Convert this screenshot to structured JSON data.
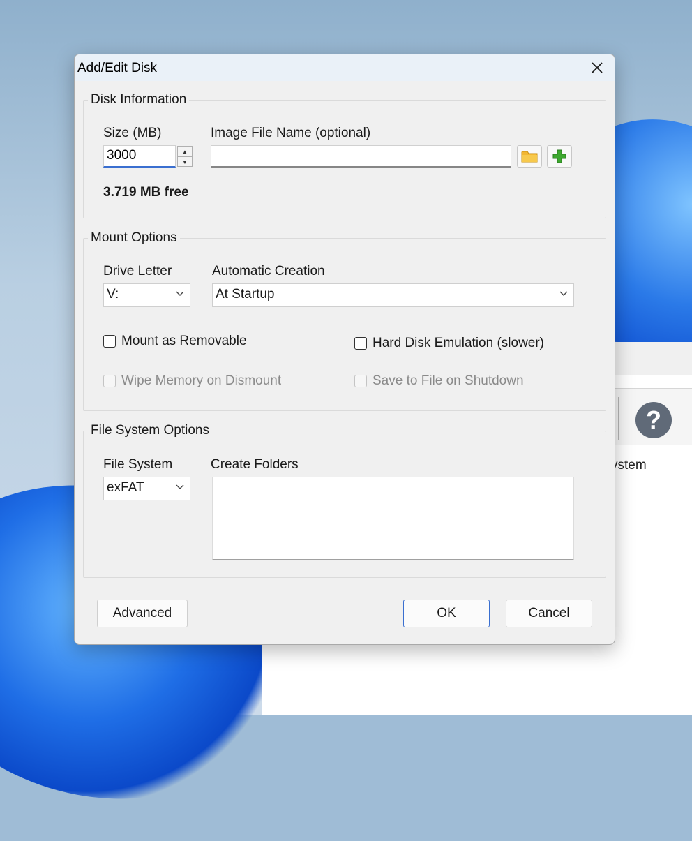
{
  "background_window": {
    "partial_label": "ystem"
  },
  "dialog": {
    "title": "Add/Edit Disk",
    "disk_info": {
      "group_title": "Disk Information",
      "size_label": "Size (MB)",
      "size_value": "3000",
      "image_file_label": "Image File Name (optional)",
      "image_file_value": "",
      "free_text": "3.719 MB free"
    },
    "mount": {
      "group_title": "Mount Options",
      "drive_letter_label": "Drive Letter",
      "drive_letter_value": "V:",
      "auto_creation_label": "Automatic Creation",
      "auto_creation_value": "At Startup",
      "mount_removable": "Mount as Removable",
      "hdd_emulation": "Hard Disk Emulation (slower)",
      "wipe_memory": "Wipe Memory on Dismount",
      "save_to_file": "Save to File on Shutdown"
    },
    "fs": {
      "group_title": "File System Options",
      "fs_label": "File System",
      "fs_value": "exFAT",
      "create_folders_label": "Create Folders"
    },
    "buttons": {
      "advanced": "Advanced",
      "ok": "OK",
      "cancel": "Cancel"
    }
  },
  "colors": {
    "accent": "#3a6fd0",
    "folder": "#f2b632",
    "plus": "#3da82f"
  },
  "icons": [
    "close-icon",
    "folder-icon",
    "plus-icon",
    "help-icon",
    "chevron-down-icon"
  ]
}
